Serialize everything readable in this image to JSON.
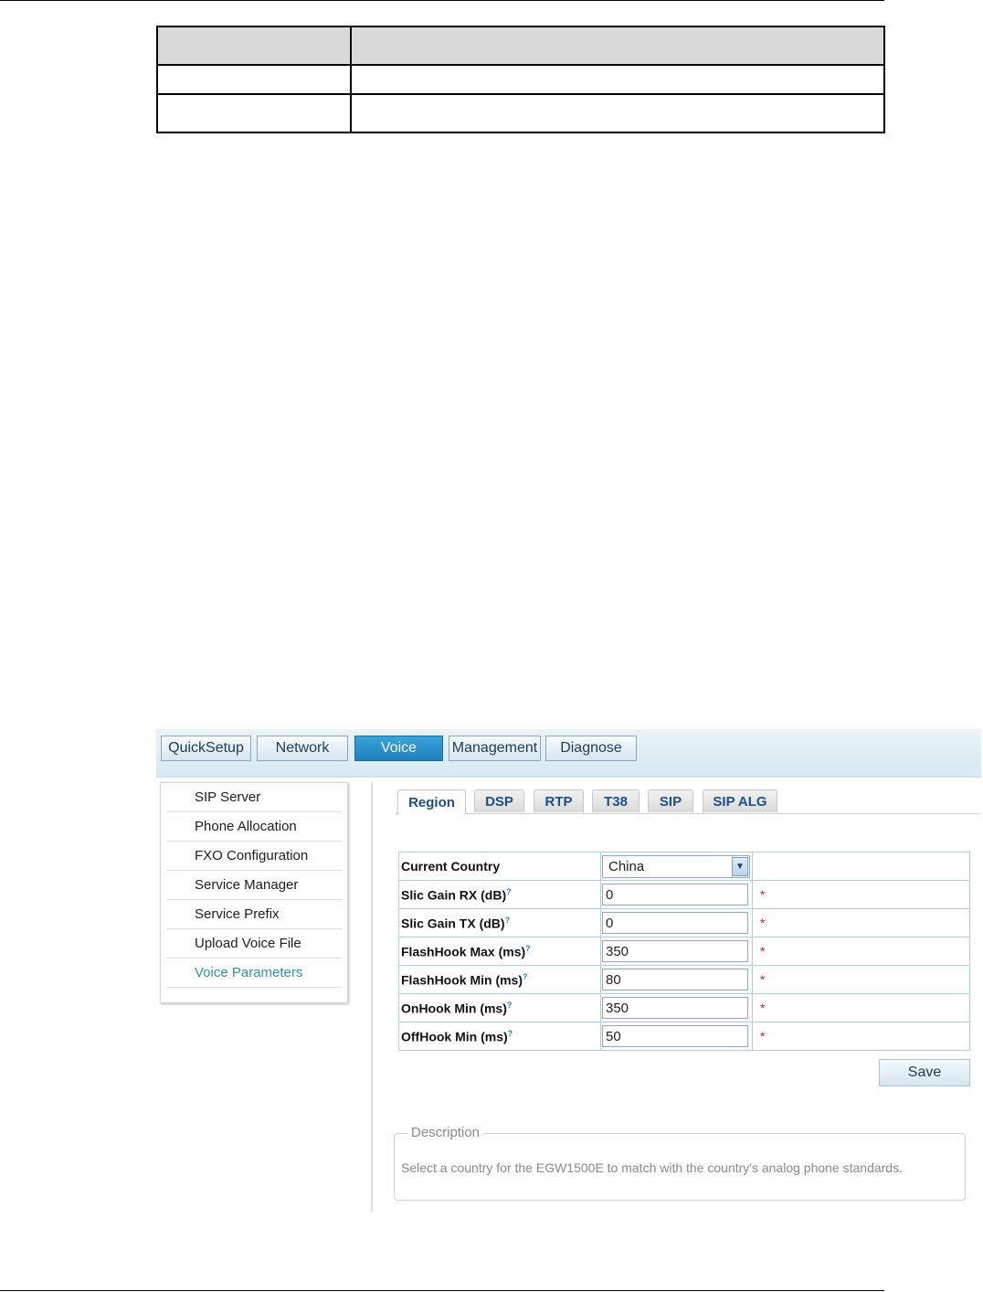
{
  "nav": {
    "items": [
      "QuickSetup",
      "Network",
      "Voice",
      "Management",
      "Diagnose"
    ],
    "active": "Voice"
  },
  "sidebar": {
    "items": [
      "SIP Server",
      "Phone Allocation",
      "FXO Configuration",
      "Service Manager",
      "Service Prefix",
      "Upload Voice File",
      "Voice Parameters"
    ],
    "active": "Voice Parameters"
  },
  "tabs": {
    "items": [
      "Region",
      "DSP",
      "RTP",
      "T38",
      "SIP",
      "SIP ALG"
    ],
    "active": "Region"
  },
  "form": {
    "country_label": "Current Country",
    "country_value": "China",
    "help_mark": "?",
    "required_mark": "*",
    "fields": [
      {
        "label": "Slic Gain RX (dB)",
        "value": "0"
      },
      {
        "label": "Slic Gain TX (dB)",
        "value": "0"
      },
      {
        "label": "FlashHook Max (ms)",
        "value": "350"
      },
      {
        "label": "FlashHook Min (ms)",
        "value": "80"
      },
      {
        "label": "OnHook Min (ms)",
        "value": "350"
      },
      {
        "label": "OffHook Min (ms)",
        "value": "50"
      }
    ]
  },
  "save_label": "Save",
  "description": {
    "title": "Description",
    "text": "Select a country for the EGW1500E to match with the country's analog phone standards."
  },
  "colors": {
    "active_nav": "#1d80bf",
    "active_sidebar": "#2b96a8",
    "required": "#e02020"
  }
}
